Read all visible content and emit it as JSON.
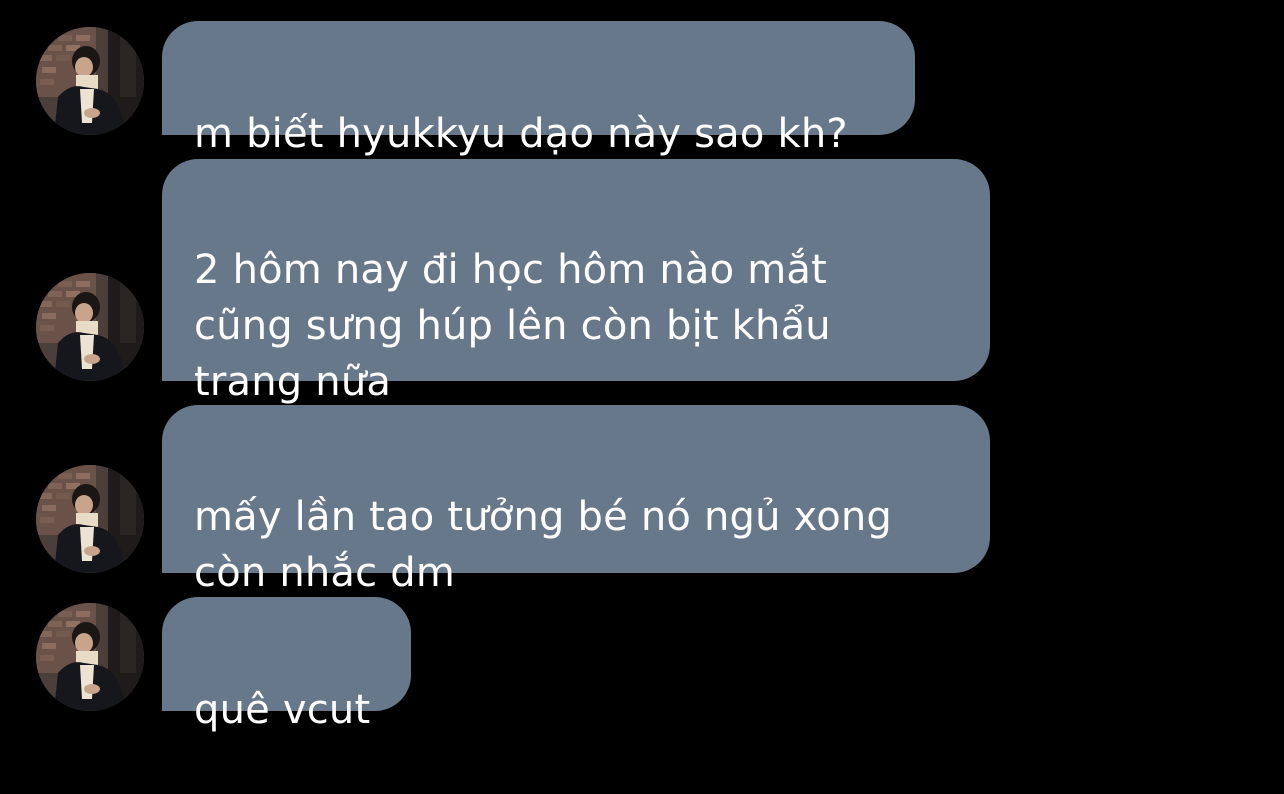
{
  "messages": [
    {
      "text": "m biết hyukkyu dạo này sao kh?"
    },
    {
      "text": "2 hôm nay đi học hôm nào mắt\ncũng sưng húp lên còn bịt khẩu\ntrang nữa"
    },
    {
      "text": "mấy lần tao tưởng bé nó ngủ xong\ncòn nhắc dm"
    },
    {
      "text": "quê vcut"
    }
  ],
  "colors": {
    "background": "#000000",
    "bubble": "#67788a",
    "bubble_text": "#ffffff"
  }
}
